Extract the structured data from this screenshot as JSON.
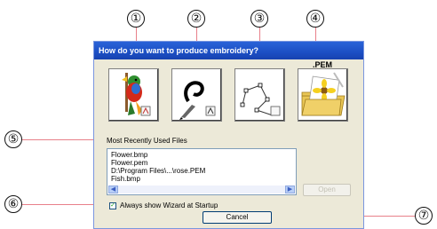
{
  "callouts": [
    "①",
    "②",
    "③",
    "④",
    "⑤",
    "⑥",
    "⑦"
  ],
  "dialog": {
    "title": "How do you want to produce embroidery?",
    "buttons": [
      {
        "icon": "parrot-image-icon"
      },
      {
        "icon": "pen-stitch-icon"
      },
      {
        "icon": "outline-points-icon"
      },
      {
        "icon": "pem-folder-flower-icon",
        "tag": ".PEM"
      }
    ],
    "mru_label": "Most Recently Used Files",
    "mru_files": [
      "Flower.bmp",
      "Flower.pem",
      "D:\\Program Files\\...\\rose.PEM",
      "Fish.bmp"
    ],
    "open_label": "Open",
    "checkbox_label": "Always show Wizard at Startup",
    "checkbox_checked": true,
    "cancel_label": "Cancel"
  }
}
